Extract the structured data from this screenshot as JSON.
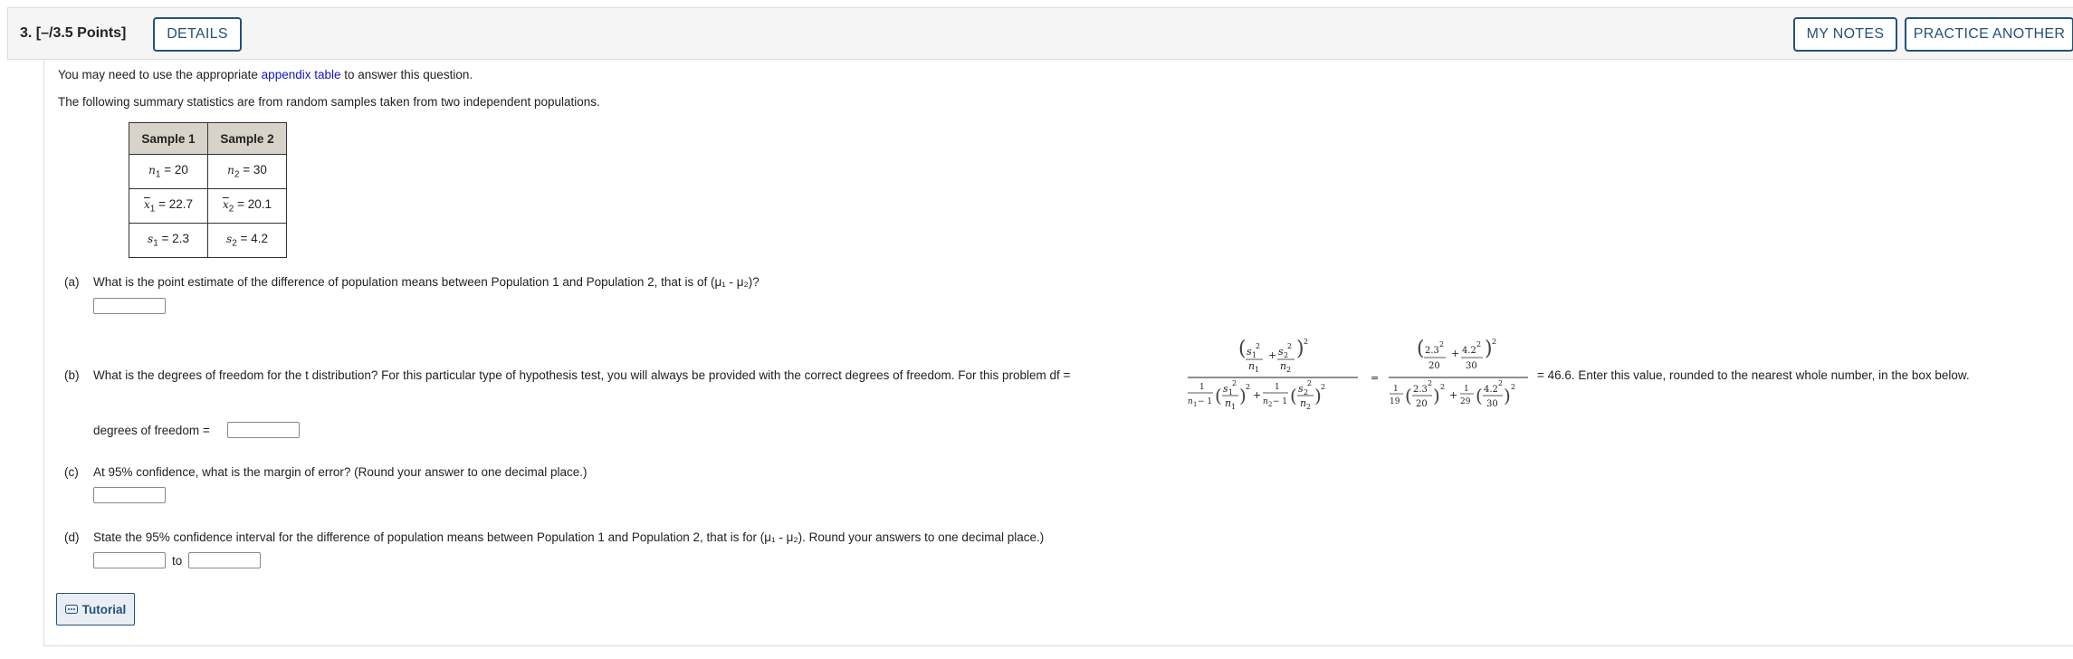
{
  "header": {
    "question_label": "3. [–/3.5 Points]",
    "details_button": "DETAILS",
    "my_notes_button": "MY NOTES",
    "practice_button": "PRACTICE ANOTHER"
  },
  "intro": {
    "line1_before": "You may need to use the appropriate ",
    "line1_link": "appendix table",
    "line1_after": " to answer this question.",
    "line2": "The following summary statistics are from random samples taken from two independent populations."
  },
  "table": {
    "headers": [
      "Sample 1",
      "Sample 2"
    ],
    "n1": "= 20",
    "n2": "= 30",
    "x1": "= 22.7",
    "x2": "= 20.1",
    "s1": "= 2.3",
    "s2": "= 4.2"
  },
  "part_a": {
    "label": "(a)",
    "text": "What is the point estimate of the difference of population means between Population 1 and Population 2, that is of (μ₁ - μ₂)?"
  },
  "part_b": {
    "label": "(b)",
    "text_before": "What is the degrees of freedom for the t distribution? For this particular type of hypothesis test, you will always be provided with the correct degrees of freedom. For this problem df =",
    "text_after": "= 46.6. Enter this value, rounded to the nearest whole number, in the box below.",
    "df_label": "degrees of freedom ="
  },
  "part_c": {
    "label": "(c)",
    "text": "At 95% confidence, what is the margin of error? (Round your answer to one decimal place.)"
  },
  "part_d": {
    "label": "(d)",
    "text": "State the 95% confidence interval for the difference of population means between Population 1 and Population 2, that is for (μ₁ - μ₂). Round your answers to one decimal place.)",
    "to_label": "to"
  },
  "tutorial_button": "Tutorial",
  "icons": {
    "tutorial": "tutorial-icon"
  },
  "colors": {
    "button_border": "#24527a",
    "link": "#1414c8",
    "table_header": "#d8d3c8"
  }
}
